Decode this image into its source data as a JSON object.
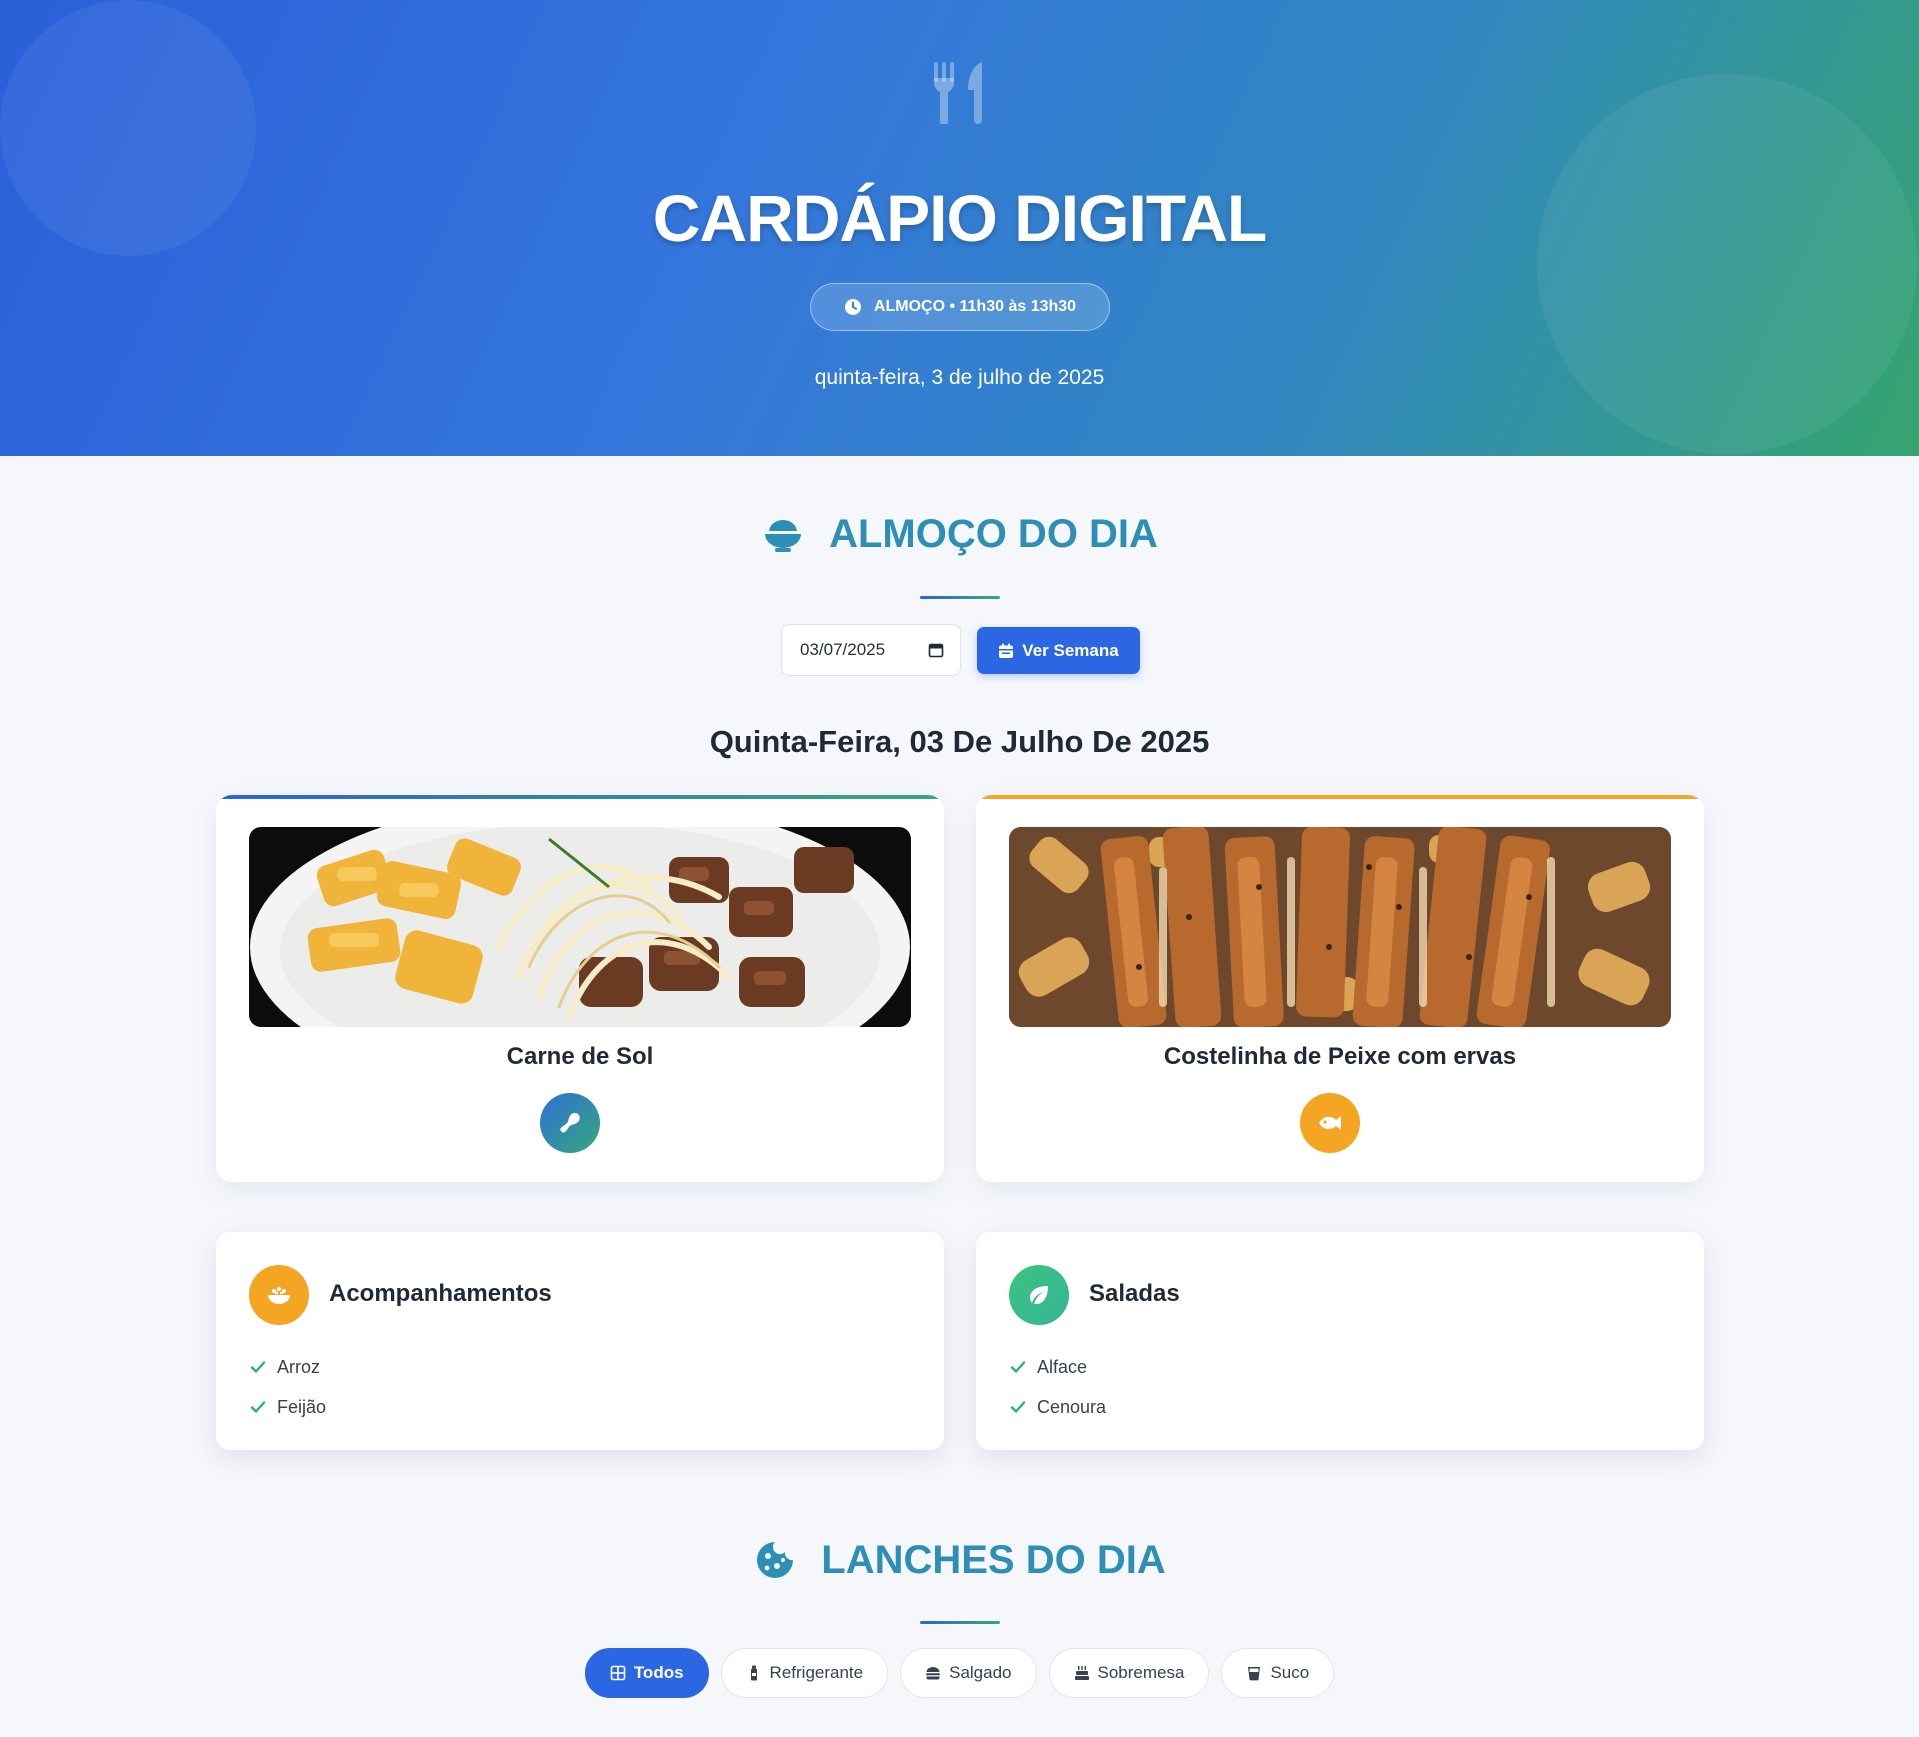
{
  "hero": {
    "title": "CARDÁPIO DIGITAL",
    "meal_period": "ALMOÇO • 11h30 às 13h30",
    "date": "quinta-feira, 3 de julho de 2025"
  },
  "lunch_section": {
    "title": "ALMOÇO DO DIA",
    "date_input_value": "03/07/2025",
    "week_button_label": "Ver Semana",
    "day_title": "Quinta-Feira, 03 De Julho De 2025",
    "dishes": [
      {
        "name": "Carne de Sol",
        "icon": "meat-icon",
        "accent": "#2e7fc6"
      },
      {
        "name": "Costelinha de Peixe com ervas",
        "icon": "fish-icon",
        "accent": "#f4a623"
      }
    ],
    "sides": {
      "title": "Acompanhamentos",
      "icon": "bowl-rice-icon",
      "items": [
        "Arroz",
        "Feijão"
      ]
    },
    "salads": {
      "title": "Saladas",
      "icon": "leaf-icon",
      "items": [
        "Alface",
        "Cenoura"
      ]
    }
  },
  "snacks_section": {
    "title": "LANCHES DO DIA",
    "filters": [
      {
        "label": "Todos",
        "icon": "grid-icon",
        "active": true
      },
      {
        "label": "Refrigerante",
        "icon": "bottle-icon",
        "active": false
      },
      {
        "label": "Salgado",
        "icon": "burger-icon",
        "active": false
      },
      {
        "label": "Sobremesa",
        "icon": "cake-icon",
        "active": false
      },
      {
        "label": "Suco",
        "icon": "glass-icon",
        "active": false
      }
    ]
  },
  "colors": {
    "primary": "#2b66e3",
    "heading": "#2d8fb6",
    "orange": "#f4a623",
    "green": "#3fc07e",
    "check": "#2bb07f"
  }
}
